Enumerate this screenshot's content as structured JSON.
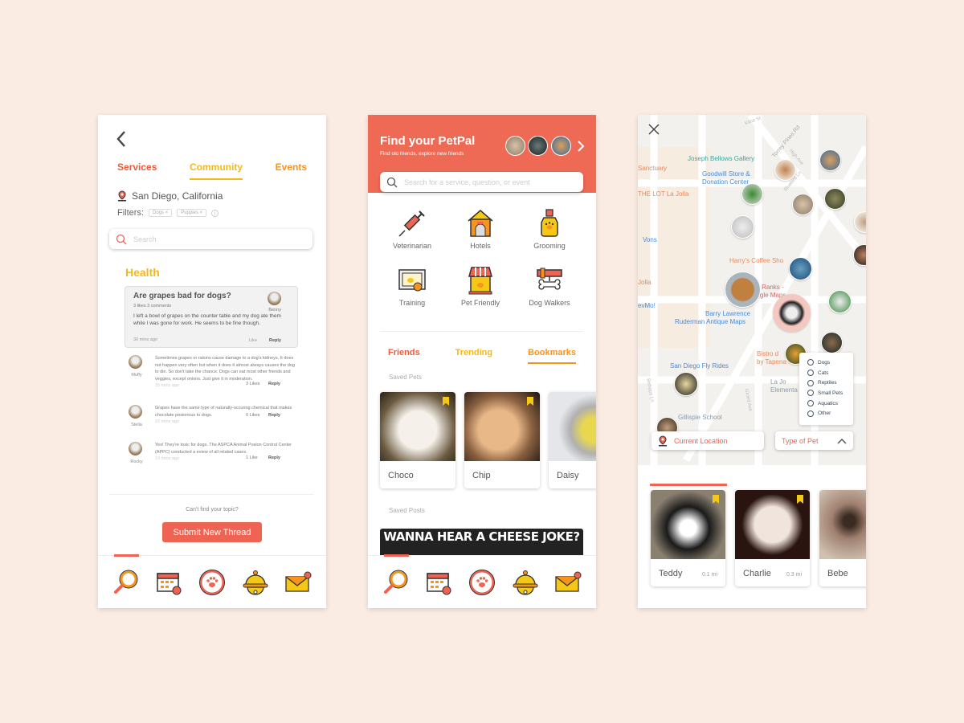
{
  "colors": {
    "accent": "#ee6352",
    "yellow": "#f5b916",
    "orange": "#f7941d",
    "background": "#fbece3"
  },
  "community": {
    "tabs": [
      {
        "label": "Services",
        "color": "#ee5a3a"
      },
      {
        "label": "Community",
        "color": "#f5b916",
        "active": true
      },
      {
        "label": "Events",
        "color": "#f7941d"
      }
    ],
    "location": "San Diego, California",
    "filters_label": "Filters:",
    "filters": [
      "Dogs ×",
      "Puppies ×"
    ],
    "search_placeholder": "Search",
    "section": "Health",
    "question": {
      "title": "Are grapes bad for dogs?",
      "stats": "3 likes   3 comments",
      "author": "Benny",
      "body": "I left a bowl of grapes on the counter table and my dog ate them while I was gone for work. He seems to be fine though.",
      "time": "30 mins ago",
      "like": "Like",
      "reply": "Reply"
    },
    "comments": [
      {
        "name": "Muffy",
        "text": "Sometimes grapes or raisins cause damage to a dog's kidneys. It does not happen very often but when it does it almost always causes the dog to die. So don't take the chance. Dogs can eat most other friends and veggies, except onions. Just give it in moderation.",
        "likes": "3 Likes",
        "reply": "Reply",
        "time": "15 mins ago"
      },
      {
        "name": "Stella",
        "text": "Grapes have the same type of naturally-occuring chemical that makes chocolate posionous to dogs.",
        "likes": "0 Likes",
        "reply": "Reply",
        "time": "22 mins ago"
      },
      {
        "name": "Rocky",
        "text": "Yes! They're toxic for dogs. The ASPCA Animal Posion Control Center (APPC) conducted a eview of all related cases.",
        "likes": "1 Like",
        "reply": "Reply",
        "time": "19 mins ago"
      }
    ],
    "cant_find": "Can't find your topic?",
    "submit": "Submit New Thread"
  },
  "home": {
    "title": "Find your PetPal",
    "subtitle": "Find old friends, explore new friends",
    "search_placeholder": "Search for a service, question, or event",
    "services": [
      "Veterinarian",
      "Hotels",
      "Grooming",
      "Training",
      "Pet Friendly",
      "Dog Walkers"
    ],
    "tabs": [
      {
        "label": "Friends",
        "color": "#ee5a3a"
      },
      {
        "label": "Trending",
        "color": "#f5b916"
      },
      {
        "label": "Bookmarks",
        "color": "#f7941d",
        "active": true
      }
    ],
    "saved_pets_label": "Saved Pets",
    "saved_pets": [
      {
        "name": "Choco"
      },
      {
        "name": "Chip"
      },
      {
        "name": "Daisy"
      }
    ],
    "saved_posts_label": "Saved Posts",
    "meme": "WANNA HEAR A CHEESE JOKE?"
  },
  "map": {
    "labels": [
      "Joseph Bellows Gallery",
      "Goodwill Store &",
      "Donation Center",
      "Sanctuary",
      "THE LOT La Jolla",
      "Vons",
      "Harry's Coffee Sho",
      "Barry Lawrence",
      "Ruderman Antique Maps",
      "San Diego Fly Rides",
      "Bistro d",
      "by Tapena",
      "La Jo",
      "Elementa",
      "Gillispie School",
      "ap Ranks -",
      "oogle Maps",
      "evMo!",
      "Jolla",
      "Kline St",
      "Torrey Pines Rd",
      "High Ave",
      "Bluebird Ln",
      "Girard Ave",
      "Bishops Ln"
    ],
    "current_location": "Current Location",
    "type_of_pet": "Type of Pet",
    "pet_types": [
      "Dogs",
      "Cats",
      "Reptiles",
      "Small Pets",
      "Aquatics",
      "Other"
    ],
    "nearby": [
      {
        "name": "Teddy",
        "distance": "0.1 mi"
      },
      {
        "name": "Charlie",
        "distance": "0.3 mi"
      },
      {
        "name": "Bebe",
        "distance": ""
      }
    ]
  }
}
